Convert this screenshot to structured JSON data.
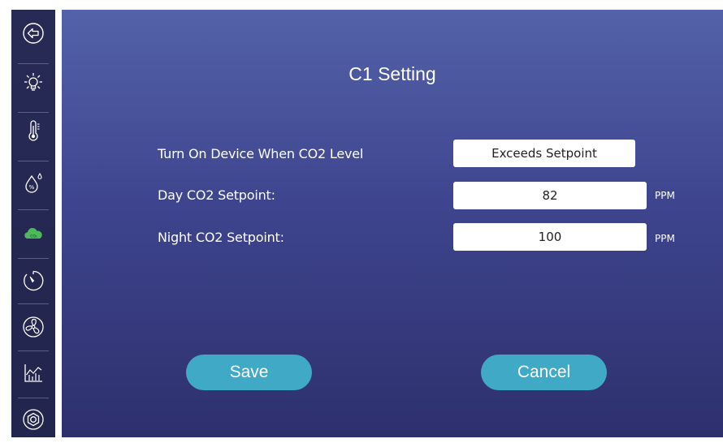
{
  "page": {
    "title": "C1 Setting"
  },
  "sidebar": {
    "items": [
      {
        "icon": "back-arrow-icon"
      },
      {
        "icon": "light-bulb-icon"
      },
      {
        "icon": "thermometer-icon"
      },
      {
        "icon": "humidity-drop-icon"
      },
      {
        "icon": "co2-cloud-icon",
        "active": true,
        "badge": "CO₂"
      },
      {
        "icon": "timer-icon"
      },
      {
        "icon": "fan-icon"
      },
      {
        "icon": "chart-icon"
      },
      {
        "icon": "settings-icon"
      }
    ]
  },
  "form": {
    "mode_label": "Turn On Device When CO2 Level",
    "mode_value": "Exceeds Setpoint",
    "day_label": "Day CO2 Setpoint:",
    "day_value": "82",
    "day_unit": "PPM",
    "night_label": "Night CO2 Setpoint:",
    "night_value": "100",
    "night_unit": "PPM"
  },
  "actions": {
    "save_label": "Save",
    "cancel_label": "Cancel"
  },
  "colors": {
    "sidebar_bg": "#262a55",
    "main_gradient_top": "#5362a9",
    "main_gradient_bottom": "#2e306d",
    "button": "#3fa9c6",
    "active_icon": "#4fb85a"
  }
}
